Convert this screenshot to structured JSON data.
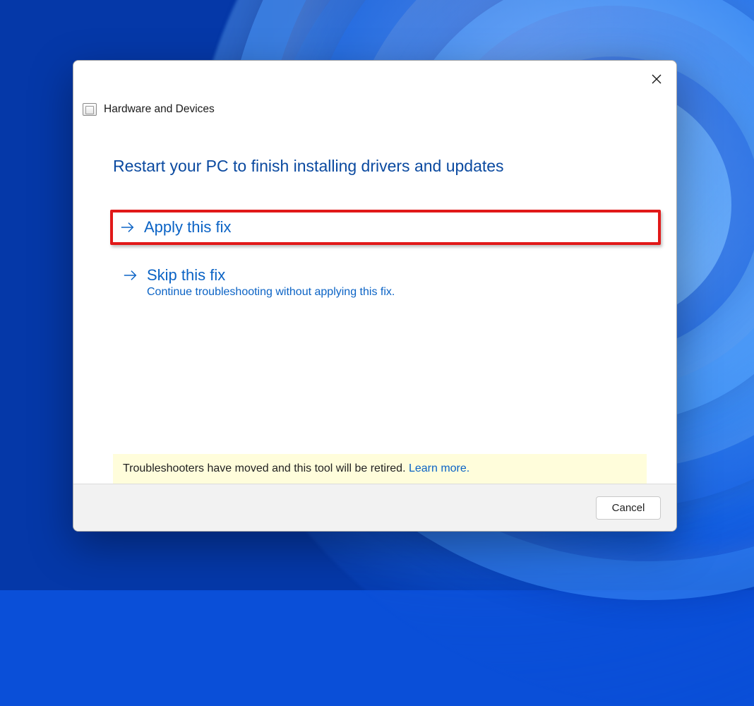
{
  "dialog": {
    "title": "Hardware and Devices",
    "heading": "Restart your PC to finish installing drivers and updates",
    "options": [
      {
        "title": "Apply this fix",
        "sub": null,
        "highlighted": true
      },
      {
        "title": "Skip this fix",
        "sub": "Continue troubleshooting without applying this fix.",
        "highlighted": false
      }
    ],
    "notice_text": "Troubleshooters have moved and this tool will be retired. ",
    "notice_link": "Learn more.",
    "cancel_label": "Cancel"
  }
}
